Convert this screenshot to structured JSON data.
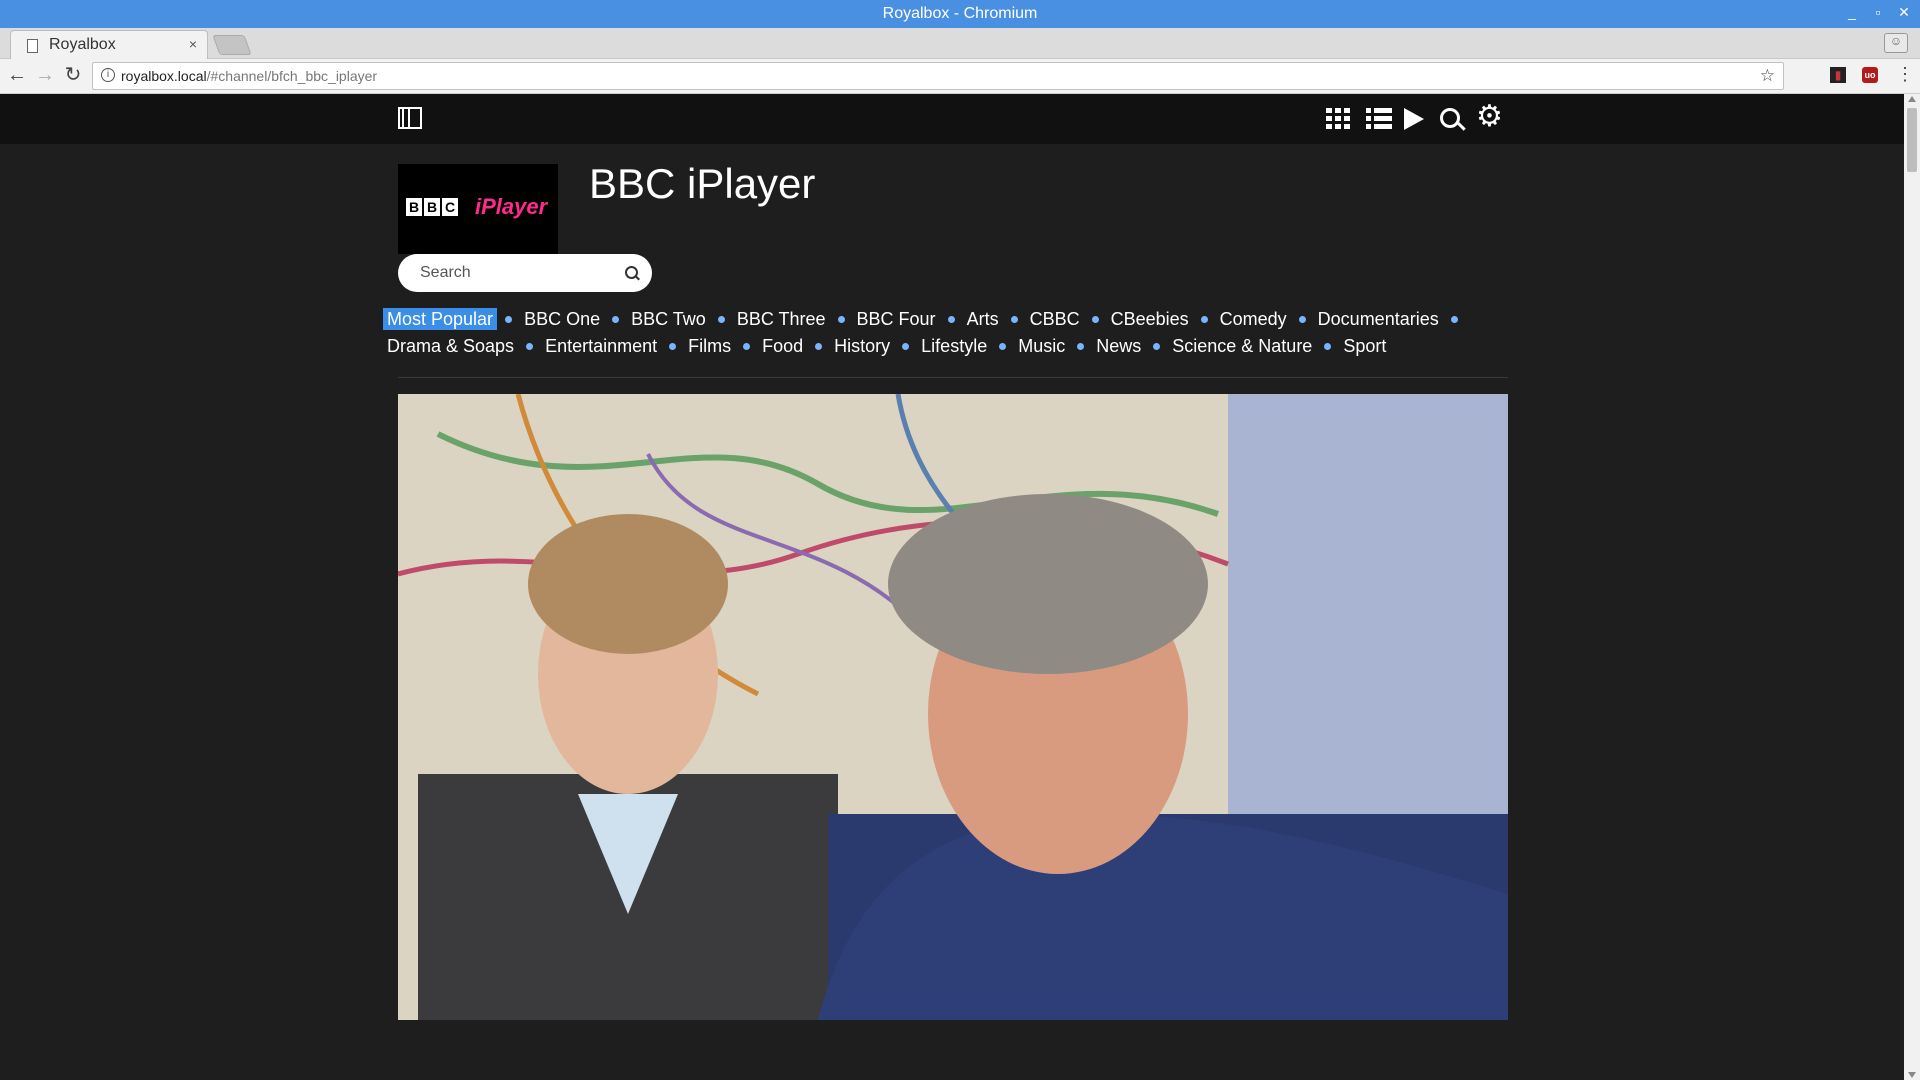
{
  "window": {
    "title": "Royalbox - Chromium",
    "controls": [
      "_",
      "▫",
      "✕"
    ]
  },
  "tab": {
    "title": "Royalbox",
    "close": "×"
  },
  "toolbar": {
    "url_host": "royalbox.local",
    "url_path": "/#channel/bfch_bbc_iplayer",
    "back": "←",
    "forward": "→",
    "reload": "↻",
    "star": "☆",
    "menu": "⋮"
  },
  "navbar": {
    "icons": [
      "film-icon",
      "grid-icon",
      "list-icon",
      "play-icon",
      "search-icon",
      "gear-icon"
    ],
    "gear_glyph": "⚙"
  },
  "channel": {
    "logo": {
      "bbc": [
        "B",
        "B",
        "C"
      ],
      "brand": "iPlayer"
    },
    "title": "BBC iPlayer",
    "search_placeholder": "Search"
  },
  "categories": {
    "active": "Most Popular",
    "items": [
      "Most Popular",
      "BBC One",
      "BBC Two",
      "BBC Three",
      "BBC Four",
      "Arts",
      "CBBC",
      "CBeebies",
      "Comedy",
      "Documentaries",
      "Drama & Soaps",
      "Entertainment",
      "Films",
      "Food",
      "History",
      "Lifestyle",
      "Music",
      "News",
      "Science & Nature",
      "Sport"
    ]
  },
  "colors": {
    "accent": "#3a8ee6",
    "titlebar": "#4a90e2",
    "page_bg": "#1e1e1e",
    "navbar_bg": "#111111",
    "brand_pink": "#ff2b8a"
  }
}
